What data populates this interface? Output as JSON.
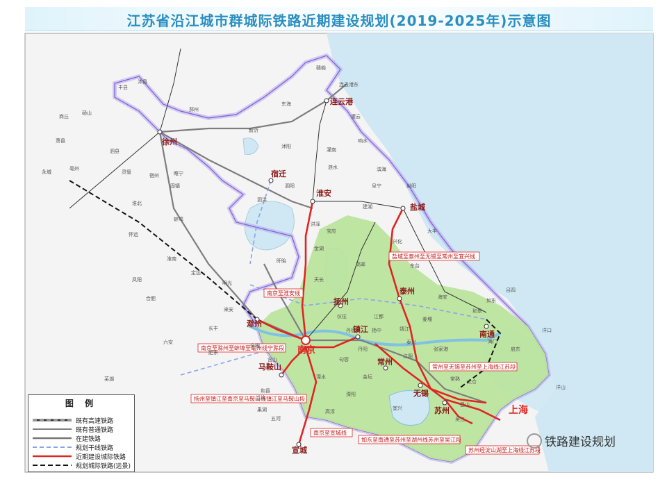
{
  "title": "江苏省沿江城市群城际铁路近期建设规划(2019-2025年)示意图",
  "watermark": "铁路建设规划",
  "legend": {
    "heading": "图 例",
    "items": [
      {
        "label": "既有高速铁路",
        "style": "hsr"
      },
      {
        "label": "既有普通铁路",
        "style": "rail"
      },
      {
        "label": "在建铁路",
        "style": "construct"
      },
      {
        "label": "规划干线铁路",
        "style": "plan_trunk"
      },
      {
        "label": "近期建设城际铁路",
        "style": "near"
      },
      {
        "label": "规划城际铁路(远景)",
        "style": "future"
      }
    ]
  },
  "sea_label": "上海",
  "cities_major": [
    "南京",
    "镇江",
    "常州",
    "无锡",
    "苏州",
    "扬州",
    "泰州",
    "南通",
    "盐城",
    "淮安",
    "宿迁",
    "徐州",
    "连云港",
    "滁州",
    "马鞍山",
    "宣城"
  ],
  "cities_minor": [
    "丰县",
    "沛县",
    "赣榆",
    "连云港东",
    "东海",
    "灌云",
    "睢宁",
    "新沂",
    "沭阳",
    "灌南",
    "泗阳",
    "响水",
    "泗洪",
    "涟水",
    "滨海",
    "阜宁",
    "射阳",
    "建湖",
    "洪泽",
    "金湖",
    "盱眙",
    "宝应",
    "高邮",
    "兴化",
    "东台",
    "大丰",
    "天长",
    "仪征",
    "江都",
    "姜堰",
    "海安",
    "如皋",
    "如东",
    "海门",
    "启东",
    "靖江",
    "泰兴",
    "张家港",
    "常熟",
    "太仓",
    "昆山",
    "吴江",
    "江阴",
    "宜兴",
    "溧阳",
    "金坛",
    "丹阳",
    "句容",
    "溧水",
    "高淳",
    "扬中",
    "丹徒",
    "邳州",
    "商丘",
    "亳州",
    "宿州",
    "淮北",
    "蚌埠",
    "淮南",
    "合肥",
    "六安",
    "芜湖",
    "巢湖",
    "明光",
    "来安",
    "全椒",
    "含山",
    "和县",
    "当涂",
    "五河",
    "固镇",
    "怀远",
    "凤阳",
    "定远",
    "长丰",
    "肥东",
    "灵璧",
    "泗县",
    "砀山",
    "萧县",
    "永城",
    "洋口",
    "吕四",
    "洋山"
  ],
  "route_labels": [
    "盐城至泰州至无锡至常州至宜兴线",
    "南京至淮安线",
    "南京至滁州至蚌埠至亳州线宁滁段",
    "常州至无锡至苏州至上海线江苏段",
    "扬州至镇江至南京至马鞍山线镇江至马鞍山段",
    "南京至宣城线",
    "如东至南通至苏州至湖州线苏州至吴江段",
    "苏州经淀山湖至上海线江苏段"
  ],
  "colors": {
    "sea": "#cfe8f4",
    "land": "#f4f4f4",
    "region": "#b9e39a",
    "province_border": "#a88fe0",
    "near_term": "#e02424",
    "hsr": "#8a8a8a",
    "title": "#2a8fc0"
  }
}
